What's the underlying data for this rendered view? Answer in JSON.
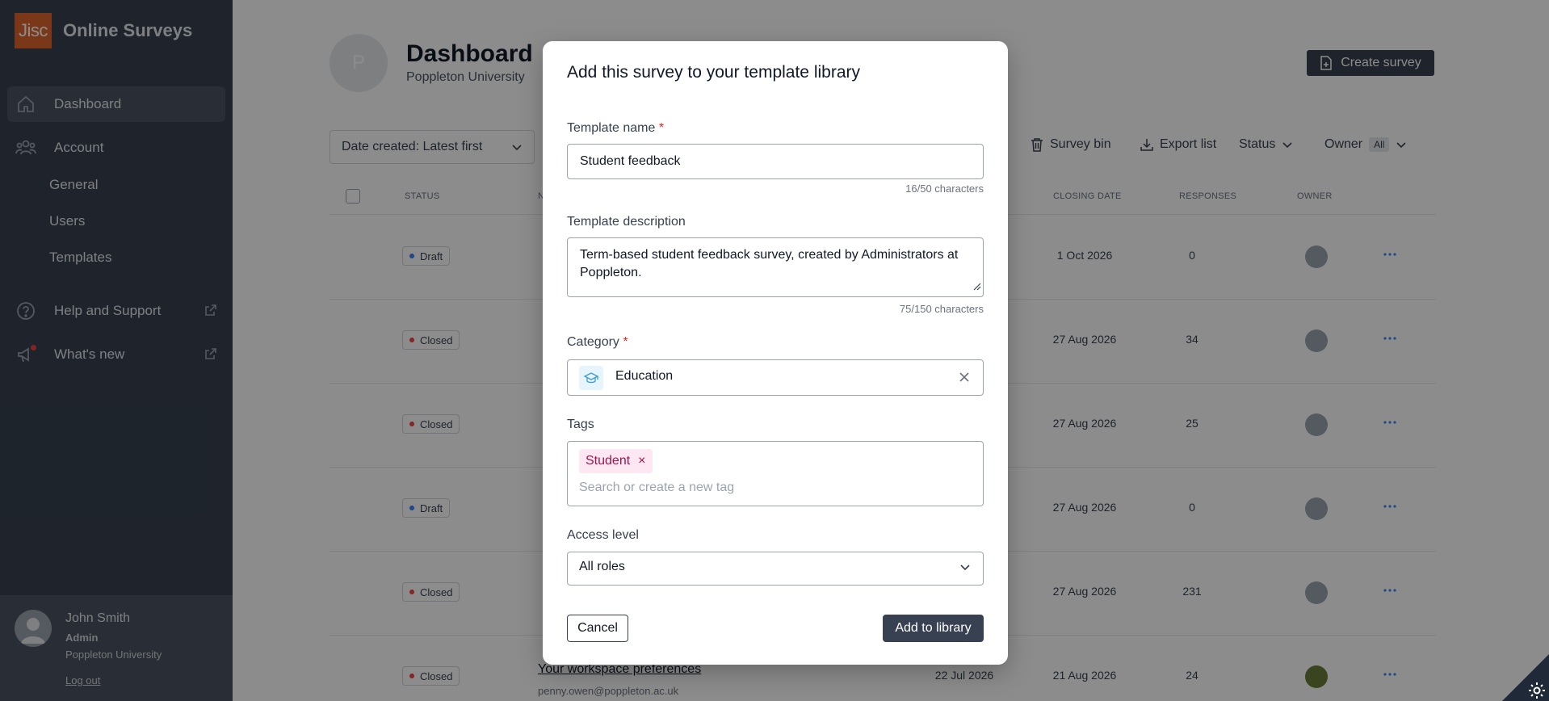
{
  "sidebar": {
    "logo_text": "Jisc",
    "app_name": "Online Surveys",
    "nav": {
      "dashboard": "Dashboard",
      "account": "Account",
      "general": "General",
      "users": "Users",
      "templates": "Templates",
      "help": "Help and Support",
      "whats_new": "What's new"
    },
    "user": {
      "name": "John Smith",
      "role": "Admin",
      "org": "Poppleton University",
      "logout": "Log out"
    }
  },
  "header": {
    "avatar_letter": "P",
    "title": "Dashboard",
    "subtitle": "Poppleton University",
    "create_button": "Create survey"
  },
  "toolbar": {
    "sort_label": "Date created: Latest first",
    "survey_bin": "Survey bin",
    "export_list": "Export list",
    "status": "Status",
    "owner": "Owner",
    "owner_badge": "All"
  },
  "table": {
    "headers": {
      "status": "STATUS",
      "name": "N",
      "closing": "CLOSING DATE",
      "responses": "RESPONSES",
      "owner": "OWNER"
    },
    "rows": [
      {
        "status": "Draft",
        "created": "",
        "closing": "1 Oct 2026",
        "responses": "0",
        "title": "",
        "email": ""
      },
      {
        "status": "Closed",
        "created": "",
        "closing": "27 Aug 2026",
        "responses": "34",
        "title": "",
        "email": ""
      },
      {
        "status": "Closed",
        "created": "",
        "closing": "27 Aug 2026",
        "responses": "25",
        "title": "",
        "email": ""
      },
      {
        "status": "Draft",
        "created": "",
        "closing": "27 Aug 2026",
        "responses": "0",
        "title": "",
        "email": ""
      },
      {
        "status": "Closed",
        "created": "",
        "closing": "27 Aug 2026",
        "responses": "231",
        "title": "",
        "email": ""
      },
      {
        "status": "Closed",
        "created": "22 Jul 2026",
        "closing": "21 Aug 2026",
        "responses": "24",
        "title": "Your workspace preferences",
        "email": "penny.owen@poppleton.ac.uk"
      }
    ]
  },
  "colors": {
    "draft_dot": "#3b82f6",
    "closed_dot": "#ef4444",
    "accent": "#374151",
    "brand": "#e0662f"
  },
  "modal": {
    "title": "Add this survey to your template library",
    "template_name_label": "Template name",
    "template_name_value": "Student feedback",
    "template_name_counter": "16/50 characters",
    "description_label": "Template description",
    "description_value": "Term-based student feedback survey, created by Administrators at Poppleton.",
    "description_counter": "75/150 characters",
    "category_label": "Category",
    "category_value": "Education",
    "tags_label": "Tags",
    "tag_chip": "Student",
    "tags_placeholder": "Search or create a new tag",
    "access_label": "Access level",
    "access_value": "All roles",
    "cancel": "Cancel",
    "submit": "Add to library",
    "required_mark": "*"
  }
}
